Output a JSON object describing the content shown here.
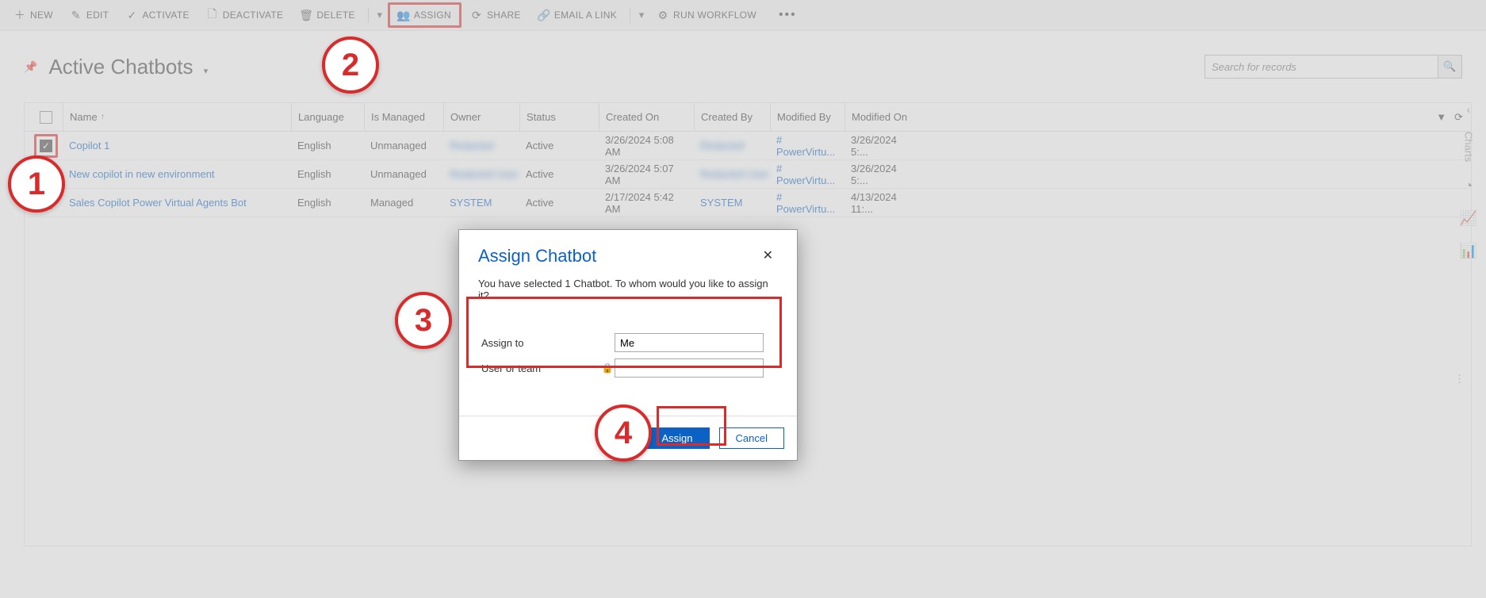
{
  "toolbar": {
    "new": "NEW",
    "edit": "EDIT",
    "activate": "ACTIVATE",
    "deactivate": "DEACTIVATE",
    "delete": "DELETE",
    "assign": "ASSIGN",
    "share": "SHARE",
    "email": "EMAIL A LINK",
    "workflow": "RUN WORKFLOW"
  },
  "view": {
    "title": "Active Chatbots",
    "search_placeholder": "Search for records"
  },
  "columns": {
    "name": "Name",
    "language": "Language",
    "is_managed": "Is Managed",
    "owner": "Owner",
    "status": "Status",
    "created_on": "Created On",
    "created_by": "Created By",
    "modified_by": "Modified By",
    "modified_on": "Modified On"
  },
  "rows": [
    {
      "checked": true,
      "name": "Copilot 1",
      "language": "English",
      "is_managed": "Unmanaged",
      "owner": "Redacted",
      "owner_blurred": true,
      "status": "Active",
      "created_on": "3/26/2024 5:08 AM",
      "created_by": "Redacted",
      "created_by_blurred": true,
      "modified_by": "# PowerVirtu...",
      "modified_on": "3/26/2024 5:..."
    },
    {
      "checked": false,
      "name": "New copilot in new environment",
      "language": "English",
      "is_managed": "Unmanaged",
      "owner": "Redacted User",
      "owner_blurred": true,
      "status": "Active",
      "created_on": "3/26/2024 5:07 AM",
      "created_by": "Redacted User",
      "created_by_blurred": true,
      "modified_by": "# PowerVirtu...",
      "modified_on": "3/26/2024 5:..."
    },
    {
      "checked": false,
      "name": "Sales Copilot Power Virtual Agents Bot",
      "language": "English",
      "is_managed": "Managed",
      "owner": "SYSTEM",
      "owner_blurred": false,
      "status": "Active",
      "created_on": "2/17/2024 5:42 AM",
      "created_by": "SYSTEM",
      "created_by_blurred": false,
      "modified_by": "# PowerVirtu...",
      "modified_on": "4/13/2024 11:..."
    }
  ],
  "rail": {
    "charts": "Charts"
  },
  "dialog": {
    "title": "Assign Chatbot",
    "subtitle": "You have selected 1 Chatbot. To whom would you like to assign it?",
    "assign_to_label": "Assign to",
    "assign_to_value": "Me",
    "user_team_label": "User or team",
    "user_team_value": "",
    "assign_btn": "Assign",
    "cancel_btn": "Cancel"
  },
  "annotations": {
    "b1": "1",
    "b2": "2",
    "b3": "3",
    "b4": "4"
  }
}
